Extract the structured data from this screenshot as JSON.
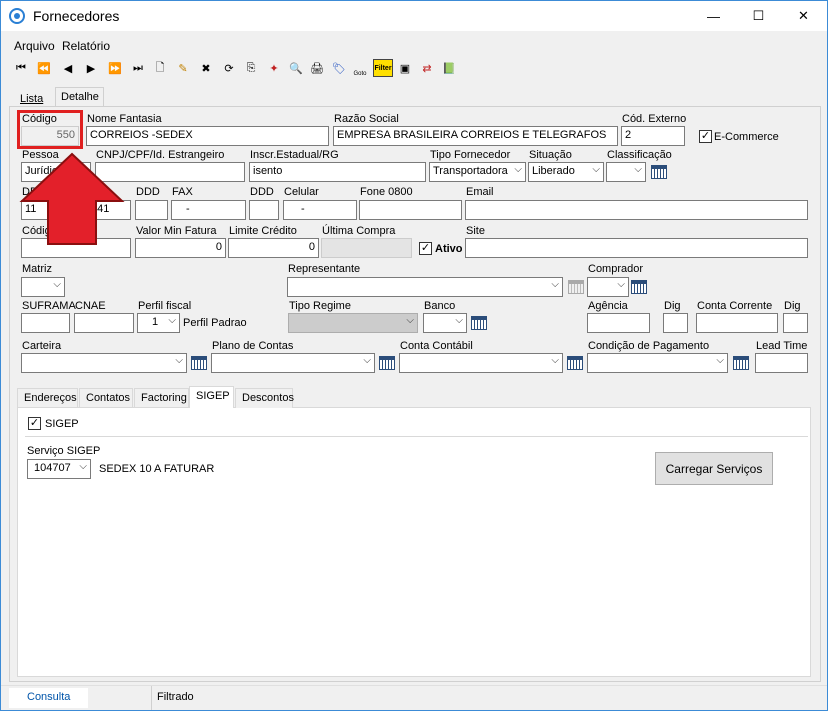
{
  "window": {
    "title": "Fornecedores",
    "minimize": "—",
    "maximize": "☐",
    "close": "✕"
  },
  "menu": {
    "arquivo": "Arquivo",
    "relatorio": "Relatório"
  },
  "toolbar": {
    "first": "⏮",
    "prev_page": "⏪",
    "prev": "◀",
    "next": "▶",
    "next_page": "⏩",
    "last": "⏭",
    "new": "🗋",
    "edit": "✎",
    "delete": "✖",
    "refresh": "⟳",
    "copy": "⎘",
    "wand": "✦",
    "preview": "🔍",
    "print": "🖨",
    "tag": "🏷",
    "goto": "Goto",
    "filter": "Filter",
    "screen": "▣",
    "export": "⇄",
    "book": "📗"
  },
  "main_tabs": {
    "lista": "Lista",
    "detalhe": "Detalhe"
  },
  "fields": {
    "codigo": {
      "label": "Código",
      "value": "550"
    },
    "nome_fantasia": {
      "label": "Nome Fantasia",
      "value": "CORREIOS -SEDEX"
    },
    "razao_social": {
      "label": "Razão Social",
      "value": "EMPRESA BRASILEIRA CORREIOS E TELEGRAFOS"
    },
    "cod_externo": {
      "label": "Cód. Externo",
      "value": "2"
    },
    "ecommerce": {
      "label": "E-Commerce",
      "checked": true
    },
    "pessoa": {
      "label": "Pessoa",
      "value": "Jurídica"
    },
    "cnpj": {
      "label": "CNPJ/CPF/Id. Estrangeiro",
      "value": ""
    },
    "inscr_estadual": {
      "label": "Inscr.Estadual/RG",
      "value": "isento"
    },
    "tipo_fornecedor": {
      "label": "Tipo Fornecedor",
      "value": "Transportadora"
    },
    "situacao": {
      "label": "Situação",
      "value": "Liberado"
    },
    "classificacao": {
      "label": "Classificação",
      "value": ""
    },
    "ddd1": {
      "label": "DD",
      "value": "11"
    },
    "fone1": {
      "value": "141"
    },
    "ddd_fax": {
      "label": "DDD",
      "value": ""
    },
    "fax": {
      "label": "FAX",
      "value": "-"
    },
    "ddd_cel": {
      "label": "DDD",
      "value": ""
    },
    "celular": {
      "label": "Celular",
      "value": "-"
    },
    "fone0800": {
      "label": "Fone 0800",
      "value": ""
    },
    "email": {
      "label": "Email",
      "value": ""
    },
    "codigo2": {
      "label": "Códig",
      "value": ""
    },
    "valor_min_fatura": {
      "label": "Valor Min Fatura",
      "value": "0"
    },
    "limite_credito": {
      "label": "Limite Crédito",
      "value": "0"
    },
    "ultima_compra": {
      "label": "Última Compra",
      "value": ""
    },
    "ativo": {
      "label": "Ativo",
      "checked": true
    },
    "site": {
      "label": "Site",
      "value": ""
    },
    "matriz": {
      "label": "Matriz",
      "value": ""
    },
    "representante": {
      "label": "Representante",
      "value": ""
    },
    "comprador": {
      "label": "Comprador",
      "value": ""
    },
    "suframa": {
      "label": "SUFRAMA",
      "value": ""
    },
    "cnae": {
      "label": "CNAE",
      "value": ""
    },
    "perfil_fiscal": {
      "label": "Perfil fiscal",
      "value": "1",
      "desc": "Perfil Padrao"
    },
    "tipo_regime": {
      "label": "Tipo Regime",
      "value": ""
    },
    "banco": {
      "label": "Banco",
      "value": ""
    },
    "agencia": {
      "label": "Agência",
      "value": ""
    },
    "dig1": {
      "label": "Dig",
      "value": ""
    },
    "conta_corrente": {
      "label": "Conta Corrente",
      "value": ""
    },
    "dig2": {
      "label": "Dig",
      "value": ""
    },
    "carteira": {
      "label": "Carteira",
      "value": ""
    },
    "plano_contas": {
      "label": "Plano de Contas",
      "value": ""
    },
    "conta_contabil": {
      "label": "Conta Contábil",
      "value": ""
    },
    "condicao_pagamento": {
      "label": "Condição de Pagamento",
      "value": ""
    },
    "lead_time": {
      "label": "Lead Time",
      "value": ""
    }
  },
  "sub_tabs": {
    "enderecos": "Endereços",
    "contatos": "Contatos",
    "factoring": "Factoring",
    "sigep": "SIGEP",
    "descontos": "Descontos"
  },
  "sigep": {
    "checkbox_label": "SIGEP",
    "servico_label": "Serviço SIGEP",
    "servico_value": "104707",
    "servico_desc": "SEDEX 10 A FATURAR",
    "carregar_button": "Carregar Serviços"
  },
  "status": {
    "consulta": "Consulta",
    "filtrado": "Filtrado"
  },
  "colors": {
    "highlight_box": "#e02020",
    "arrow": "#e3202a",
    "accent": "#0066cc"
  }
}
